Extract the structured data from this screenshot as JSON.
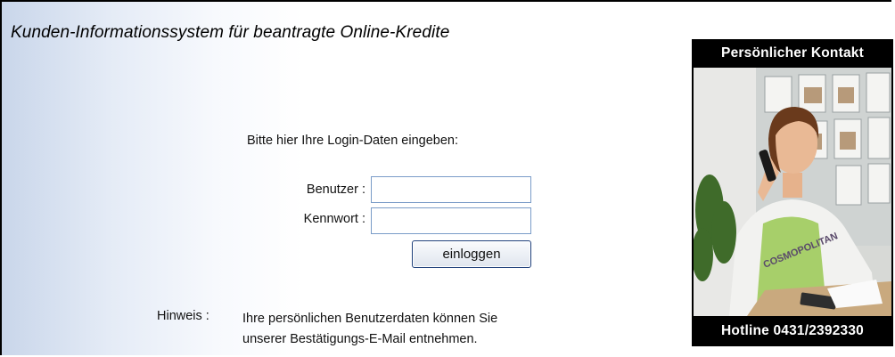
{
  "header": {
    "title": "Kunden-Informationssystem für beantragte Online-Kredite"
  },
  "login": {
    "prompt": "Bitte hier Ihre Login-Daten eingeben:",
    "user_label": "Benutzer :",
    "user_value": "",
    "password_label": "Kennwort :",
    "password_value": "",
    "submit_label": "einloggen"
  },
  "note": {
    "label": "Hinweis :",
    "line1": "Ihre persönlichen Benutzerdaten können Sie",
    "line2": "unserer Bestätigungs-E-Mail entnehmen."
  },
  "contact": {
    "heading": "Persönlicher Kontakt",
    "hotline": "Hotline 0431/2392330",
    "photo_text": "COSMOPOLITAN"
  },
  "colors": {
    "border": "#000000",
    "input_border": "#7a9cc8",
    "button_border": "#1e3f7a",
    "panel_bg": "#000000",
    "panel_text": "#ffffff"
  }
}
